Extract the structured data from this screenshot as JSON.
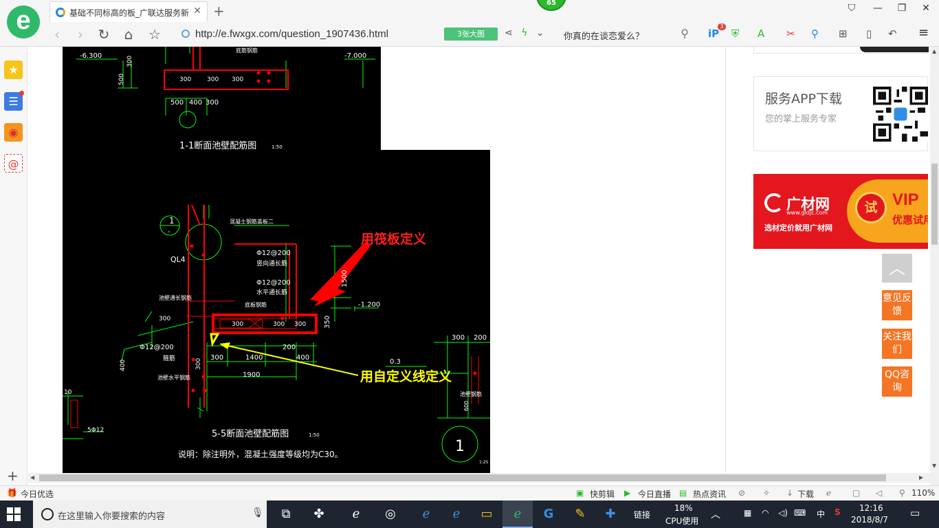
{
  "browser": {
    "tab_title": "基础不同标高的板_广联达服务新",
    "url": "http://e.fwxgx.com/question_1907436.html",
    "image_button": "3张大图",
    "search_query": "你真的在谈恋爱么？",
    "badge_count": "65",
    "ext_badge": "3"
  },
  "drawing": {
    "top_dims": [
      "-6.300",
      "-7.000",
      "500",
      "300",
      "300",
      "300",
      "300"
    ],
    "top_bottom_dims": [
      "500",
      "400",
      "300"
    ],
    "section_top_title": "1-1断面池壁配筋图",
    "scale_top": "1:50",
    "label_top_small": "底筋钢筋",
    "circle_num": "1",
    "circle_dash": "-",
    "ql4": "QL4",
    "concrete_label": "混凝土钢筋盖板二",
    "rebar1": "Φ12@200",
    "rebar1_note": "竖向通长筋",
    "rebar2": "Φ12@200",
    "rebar2_note": "水平通长筋",
    "dim_1500": "1500",
    "dim_350": "350",
    "elev_1200": "-1.200",
    "bottom_bar": "底板钢筋",
    "slab_dims": [
      "300",
      "300",
      "300"
    ],
    "wall_bar": "池壁通长钢筋",
    "dim_300_left": "300",
    "rebar3": "Φ12@200",
    "rebar3_note": "箍筋",
    "dim_400": "400",
    "dim_200": "200",
    "dims_row2": [
      "300",
      "1400",
      "400"
    ],
    "dim_1900": "1900",
    "hbar": "池壁水平钢筋",
    "dim_300_wall": "300",
    "dim_10": "10",
    "s12": "5Φ12",
    "right_dims": [
      "300",
      "200"
    ],
    "dim_03": "0.3",
    "pool_wall": "池壁钢筋",
    "dim_600": "600",
    "section_bottom_title": "5-5断面池壁配筋图",
    "scale_bottom": "1:50",
    "note": "说明：除注明外，混凝土强度等级均为C30。",
    "big_circle": "1",
    "scale_125": "1:25",
    "annotation_red": "用筏板定义",
    "annotation_yellow": "用自定义线定义"
  },
  "right_panel": {
    "app_title": "服务APP下载",
    "app_subtitle": "您的掌上服务专家",
    "ad_brand": "广材网",
    "ad_url": "www.gldjc.com",
    "ad_slogan": "选材定价就用广材网",
    "ad_trial": "试",
    "ad_vip": "VIP",
    "ad_vip_sub": "优惠试用",
    "feedback": "意见反馈",
    "follow": "关注我们",
    "qq": "QQ咨询"
  },
  "status_bar": {
    "left": "今日优选",
    "items": [
      "快剪辑",
      "今日直播",
      "热点资讯",
      "下载"
    ],
    "zoom": "110%"
  },
  "taskbar": {
    "search_placeholder": "在这里输入你要搜索的内容",
    "link": "链接",
    "cpu_percent": "18%",
    "cpu_label": "CPU使用",
    "ime": "中",
    "time": "12:16",
    "date": "2018/8/7"
  },
  "colors": {
    "brand_green": "#2fb96b",
    "ad_red": "#e4161e",
    "float_orange": "#f47524",
    "cad_green": "#00ff00",
    "cad_red": "#ff0000",
    "cad_yellow": "#ffff00"
  }
}
